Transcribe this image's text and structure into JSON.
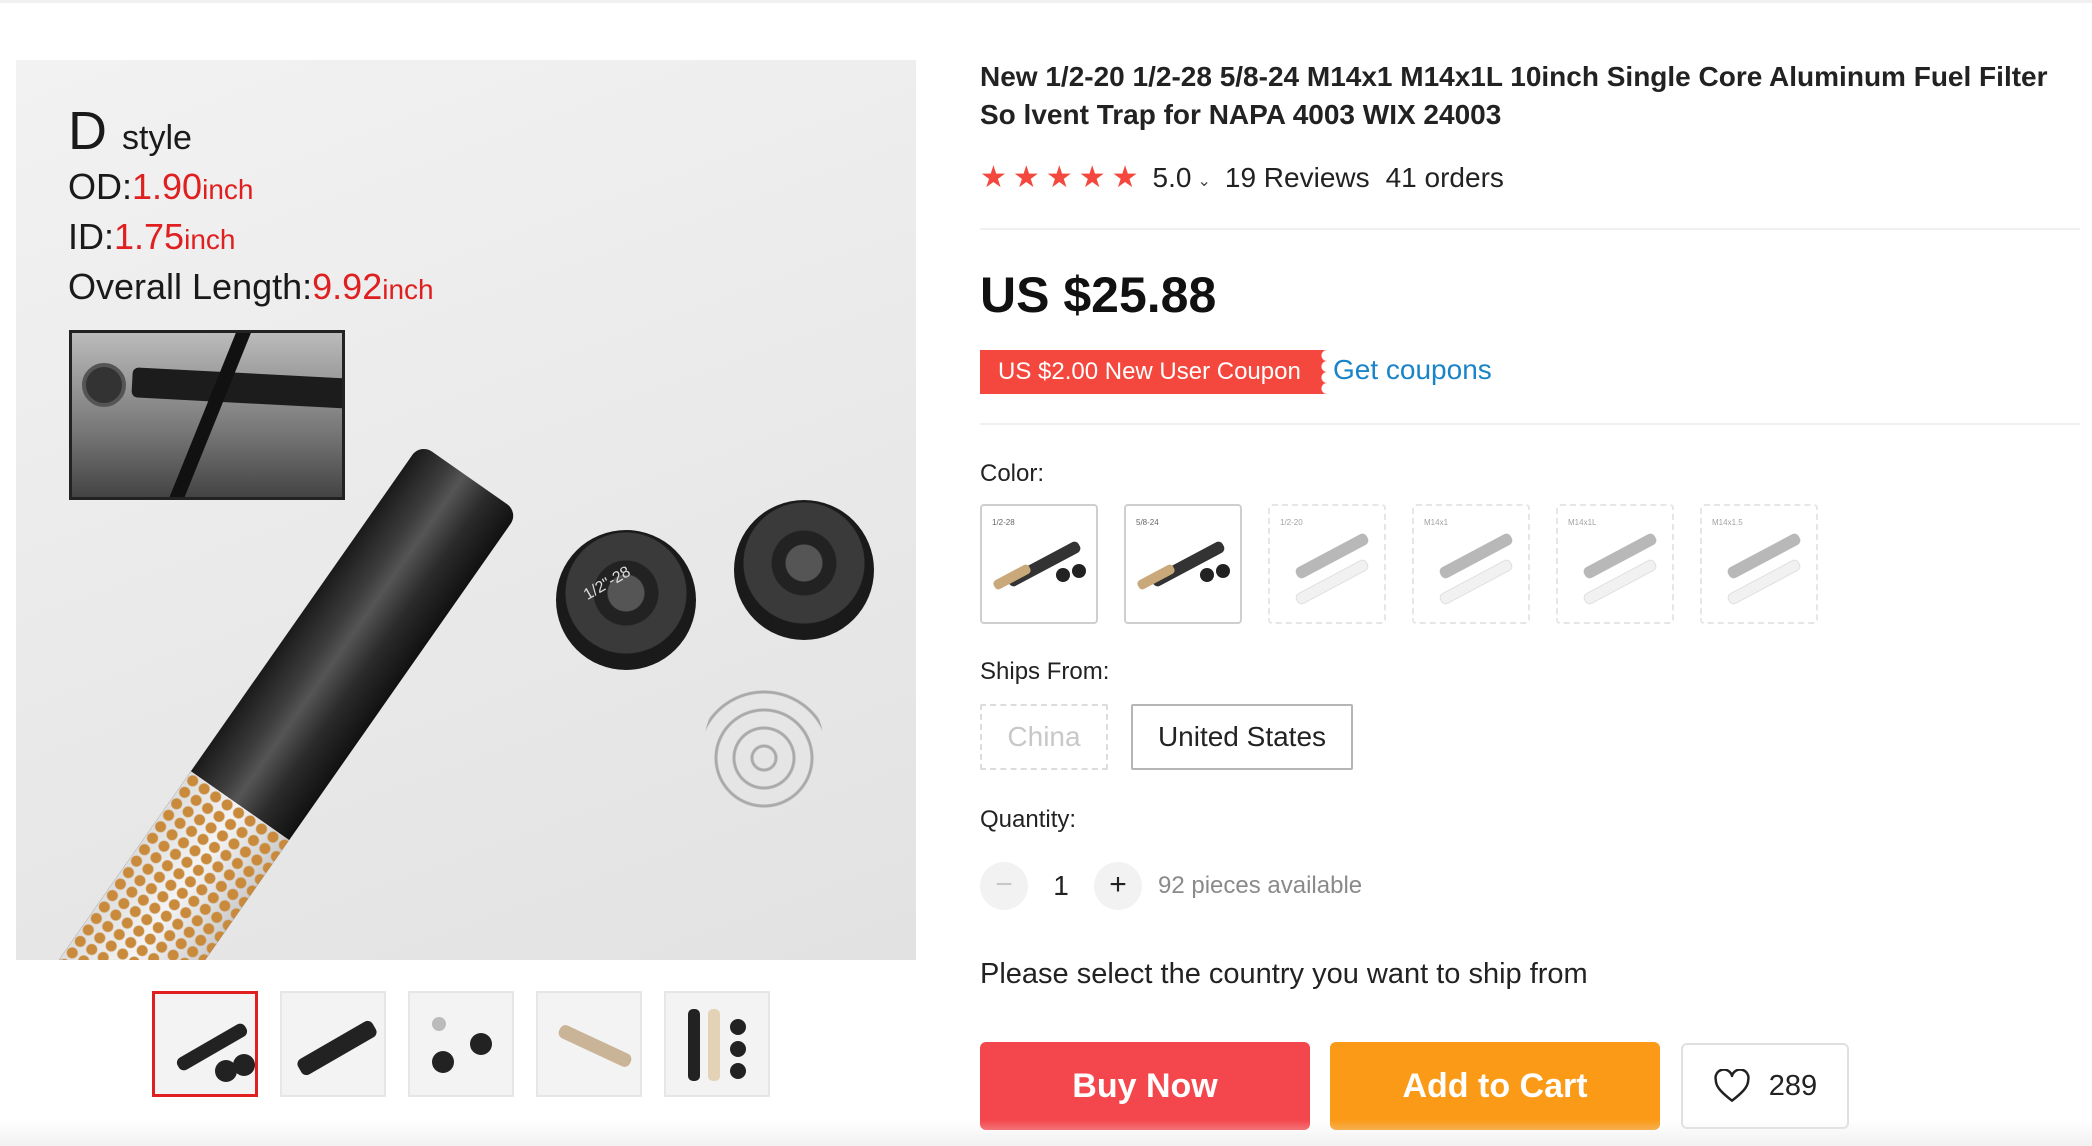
{
  "product": {
    "title": "New 1/2-20 1/2-28 5/8-24 M14x1 M14x1L 10inch Single Core Aluminum Fuel Filter So lvent Trap for NAPA 4003 WIX 24003",
    "rating": "5.0",
    "stars": 5,
    "reviews": "19 Reviews",
    "orders": "41 orders",
    "price": "US $25.88"
  },
  "image_text": {
    "style_letter": "D",
    "style_word": "style",
    "od_label": "OD:",
    "od_value": "1.90",
    "id_label": "ID:",
    "id_value": "1.75",
    "length_label": "Overall Length:",
    "length_value": "9.92",
    "unit": "inch",
    "cap_marking": "1/2\"-28"
  },
  "coupon": {
    "label": "US $2.00 New User Coupon",
    "link": "Get coupons"
  },
  "color": {
    "label": "Color:",
    "options": [
      {
        "tag": "1/2-28",
        "state": "available"
      },
      {
        "tag": "5/8-24",
        "state": "available"
      },
      {
        "tag": "1/2-20",
        "state": "disabled"
      },
      {
        "tag": "M14x1",
        "state": "disabled"
      },
      {
        "tag": "M14x1L",
        "state": "disabled"
      },
      {
        "tag": "M14x1.5",
        "state": "disabled"
      }
    ]
  },
  "ships_from": {
    "label": "Ships From:",
    "options": [
      {
        "name": "China",
        "state": "disabled"
      },
      {
        "name": "United States",
        "state": "available"
      }
    ]
  },
  "quantity": {
    "label": "Quantity:",
    "minus": "−",
    "plus": "+",
    "value": "1",
    "available": "92 pieces available"
  },
  "message": "Please select the country you want to ship from",
  "actions": {
    "buy_now": "Buy Now",
    "add_to_cart": "Add to Cart",
    "wishlist_count": "289"
  },
  "colors": {
    "accent_red": "#f4473d",
    "cart_orange": "#fb9a17",
    "link_blue": "#1a84c8",
    "spec_red": "#e02020"
  },
  "icons": {
    "star": "star-icon",
    "chevron": "chevron-down-icon",
    "heart": "heart-icon"
  }
}
